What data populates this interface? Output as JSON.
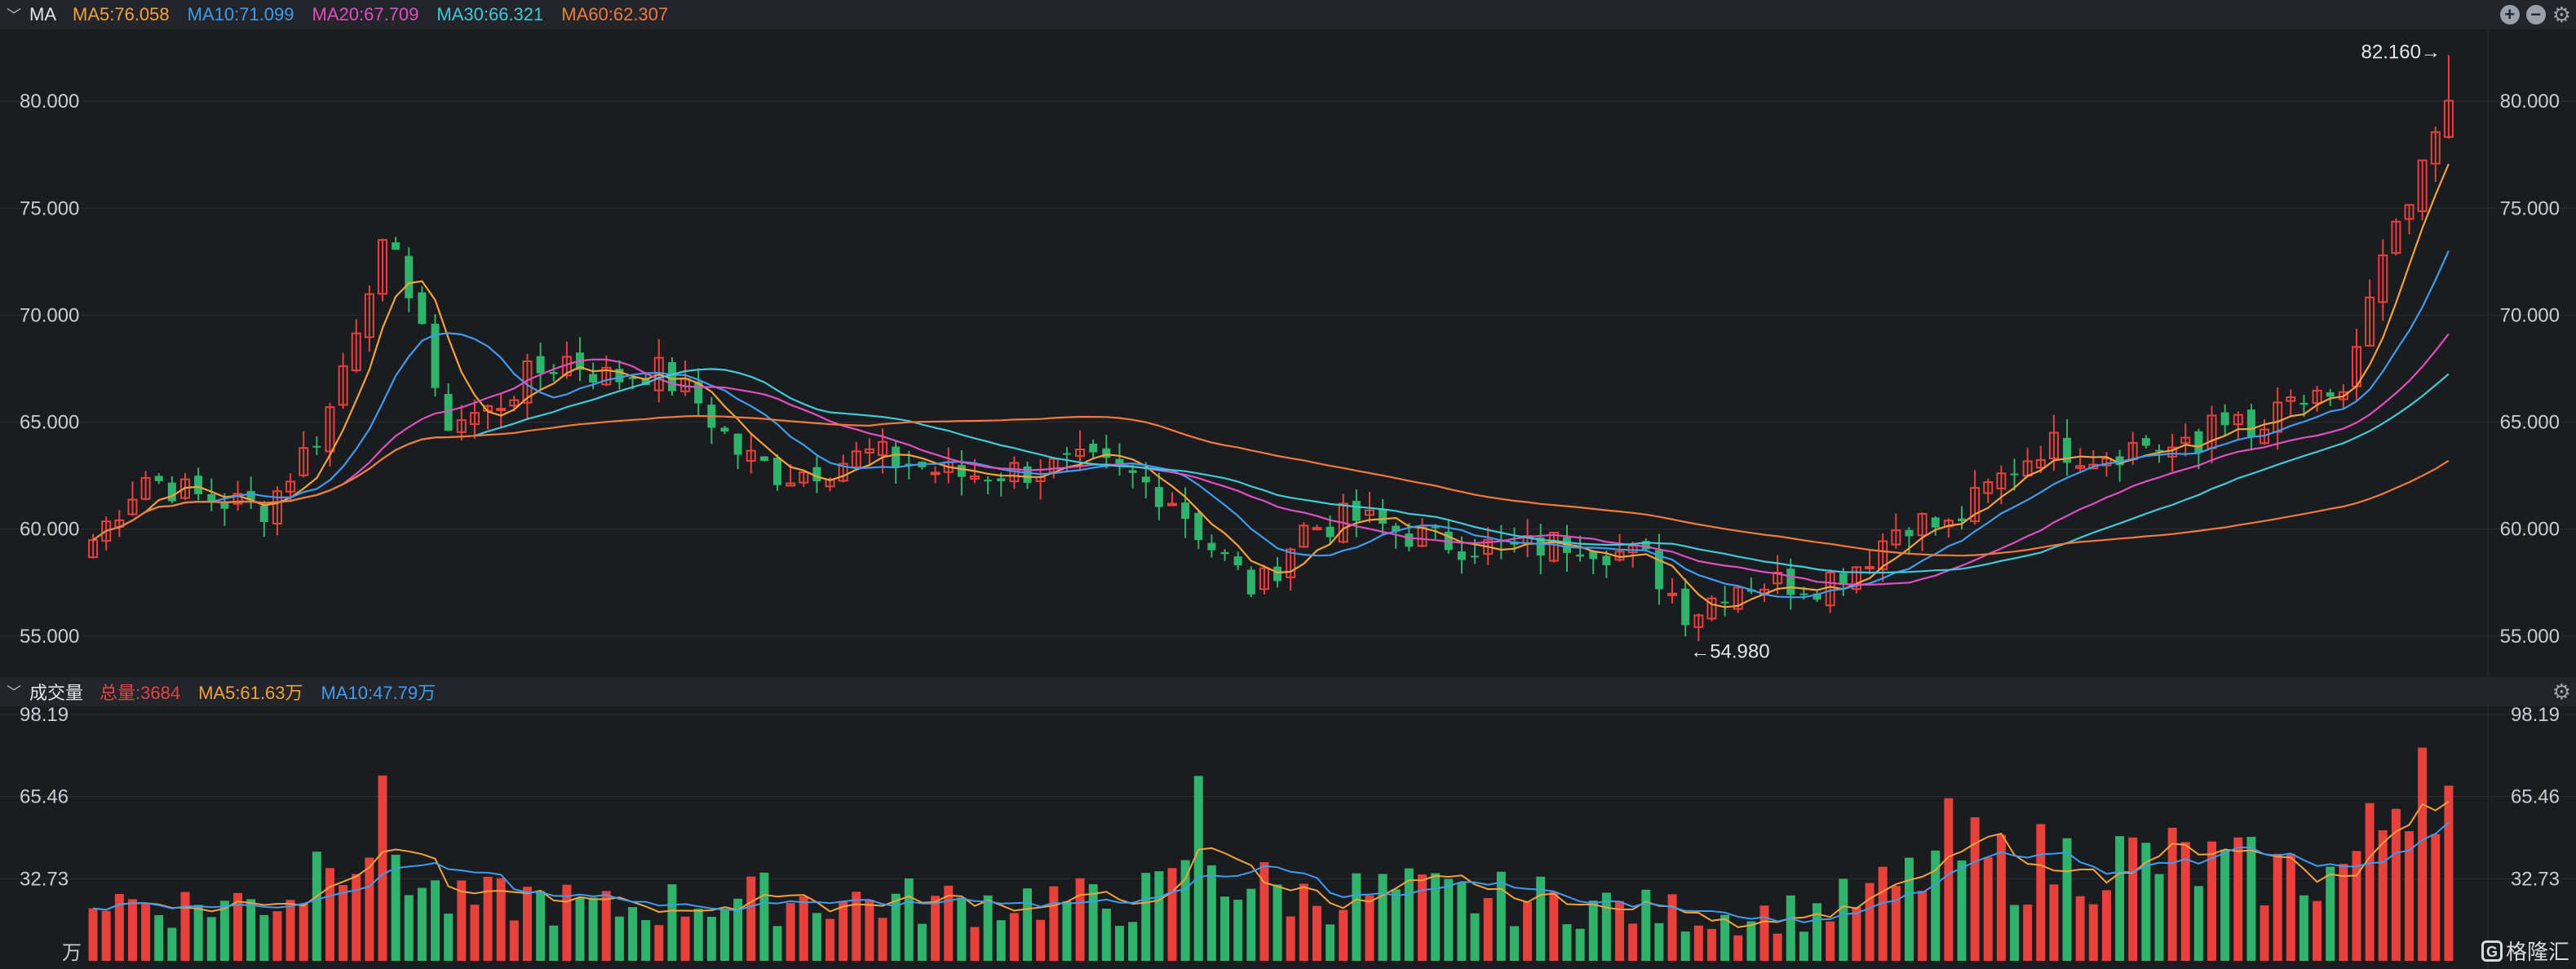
{
  "price_panel": {
    "indicator": "MA",
    "legend": [
      {
        "label": "MA5:76.058",
        "color": "#f2a13b"
      },
      {
        "label": "MA10:71.099",
        "color": "#3d9cf0"
      },
      {
        "label": "MA20:67.709",
        "color": "#e04fc0"
      },
      {
        "label": "MA30:66.321",
        "color": "#3fc9d9"
      },
      {
        "label": "MA60:62.307",
        "color": "#f07a3b"
      }
    ],
    "max_label": "82.160→",
    "min_label": "←54.980"
  },
  "volume_panel": {
    "indicator": "成交量",
    "legend": [
      {
        "label": "总量:3684",
        "color": "#e04444"
      },
      {
        "label": "MA5:61.63万",
        "color": "#f2a13b"
      },
      {
        "label": "MA10:47.79万",
        "color": "#3d9cf0"
      }
    ],
    "unit": "万"
  },
  "watermark": {
    "text": "格隆汇",
    "logo": "G"
  },
  "colors": {
    "up": "#e8413c",
    "down": "#2fb26a",
    "grid": "#2a2c32",
    "bg": "#1b1c20"
  },
  "chart_data": [
    {
      "type": "candlestick",
      "ylim": [
        54.0,
        82.6
      ],
      "y_ticks": [
        "80.000",
        "75.000",
        "70.000",
        "65.000",
        "60.000",
        "55.000"
      ],
      "candle_count": 180,
      "close_trend_anchors": [
        [
          0,
          59.5
        ],
        [
          6,
          62.5
        ],
        [
          12,
          61.5
        ],
        [
          20,
          61.0
        ],
        [
          27,
          65.0
        ],
        [
          30,
          69.0
        ],
        [
          33,
          73.0
        ],
        [
          36,
          72.0
        ],
        [
          38,
          70.0
        ],
        [
          40,
          65.0
        ],
        [
          46,
          65.5
        ],
        [
          50,
          67.0
        ],
        [
          55,
          68.0
        ],
        [
          60,
          67.0
        ],
        [
          65,
          67.5
        ],
        [
          70,
          66.0
        ],
        [
          75,
          63.5
        ],
        [
          80,
          62.5
        ],
        [
          90,
          63.5
        ],
        [
          100,
          62.5
        ],
        [
          110,
          62.8
        ],
        [
          115,
          63.0
        ],
        [
          120,
          62.5
        ],
        [
          125,
          61.5
        ],
        [
          130,
          59.0
        ],
        [
          135,
          57.0
        ],
        [
          140,
          60.0
        ],
        [
          146,
          60.5
        ],
        [
          155,
          59.5
        ],
        [
          165,
          59.0
        ],
        [
          172,
          59.5
        ],
        [
          180,
          58.5
        ],
        [
          185,
          56.0
        ],
        [
          190,
          57.5
        ],
        [
          200,
          57.5
        ],
        [
          205,
          58.5
        ],
        [
          210,
          60.5
        ],
        [
          215,
          60.0
        ],
        [
          220,
          62.0
        ],
        [
          226,
          64.0
        ],
        [
          232,
          63.5
        ],
        [
          238,
          64.0
        ],
        [
          244,
          63.5
        ],
        [
          246,
          66.0
        ],
        [
          250,
          64.0
        ],
        [
          255,
          66.0
        ],
        [
          260,
          65.5
        ],
        [
          265,
          72.0
        ],
        [
          270,
          76.5
        ],
        [
          272,
          79.0
        ],
        [
          273,
          79.5
        ]
      ],
      "high": 82.16,
      "low": 54.98,
      "ma": [
        {
          "name": "MA5",
          "last": 76.058
        },
        {
          "name": "MA10",
          "last": 71.099
        },
        {
          "name": "MA20",
          "last": 67.709
        },
        {
          "name": "MA30",
          "last": 66.321
        },
        {
          "name": "MA60",
          "last": 62.307
        }
      ]
    },
    {
      "type": "bar",
      "unit": "万",
      "ylim": [
        0,
        98.19
      ],
      "y_ticks": [
        "98.19",
        "65.46",
        "32.73"
      ],
      "bar_count": 180,
      "volume_trend_anchors": [
        [
          0,
          25
        ],
        [
          10,
          22
        ],
        [
          20,
          24
        ],
        [
          25,
          30
        ],
        [
          28,
          60
        ],
        [
          30,
          45
        ],
        [
          33,
          55
        ],
        [
          38,
          30
        ],
        [
          42,
          22
        ],
        [
          50,
          25
        ],
        [
          60,
          20
        ],
        [
          70,
          24
        ],
        [
          80,
          25
        ],
        [
          90,
          24
        ],
        [
          100,
          23
        ],
        [
          110,
          25
        ],
        [
          118,
          22
        ],
        [
          125,
          28
        ],
        [
          128,
          60
        ],
        [
          130,
          35
        ],
        [
          140,
          25
        ],
        [
          150,
          27
        ],
        [
          160,
          25
        ],
        [
          170,
          24
        ],
        [
          180,
          20
        ],
        [
          190,
          18
        ],
        [
          200,
          20
        ],
        [
          210,
          30
        ],
        [
          215,
          45
        ],
        [
          220,
          38
        ],
        [
          230,
          40
        ],
        [
          240,
          40
        ],
        [
          250,
          35
        ],
        [
          260,
          35
        ],
        [
          265,
          50
        ],
        [
          268,
          80
        ],
        [
          271,
          98
        ],
        [
          273,
          65
        ]
      ]
    }
  ]
}
